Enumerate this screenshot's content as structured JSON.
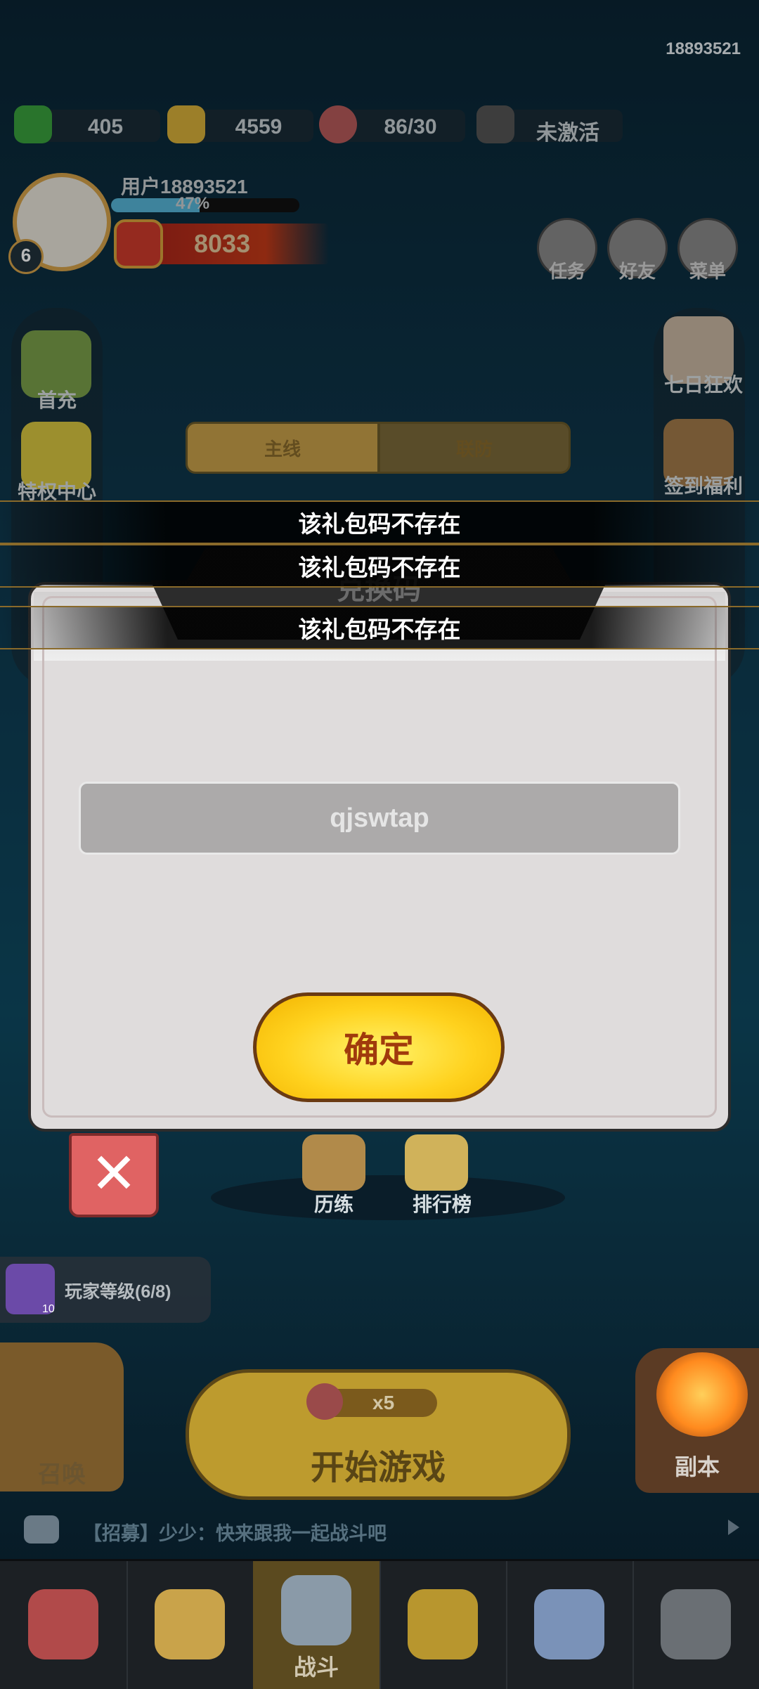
{
  "header": {
    "uid": "18893521"
  },
  "resources": [
    {
      "name": "gem",
      "value": "405",
      "color": "#3aa13d"
    },
    {
      "name": "coin",
      "value": "4559",
      "color": "#d8b03a"
    },
    {
      "name": "stamina",
      "value": "86/30",
      "color": "#b85a5a"
    },
    {
      "name": "ad-card",
      "value": "未激活",
      "color": "#555555"
    }
  ],
  "player": {
    "name": "用户18893521",
    "xp_percent_label": "47%",
    "xp_fraction": 0.47,
    "level": "6",
    "power": "8033"
  },
  "top_right_buttons": [
    {
      "icon": "scroll-icon",
      "label": "任务"
    },
    {
      "icon": "friends-icon",
      "label": "好友"
    },
    {
      "icon": "menu-icon",
      "label": "菜单"
    }
  ],
  "left_menu": [
    {
      "icon": "first-recharge-icon",
      "label": "首充"
    },
    {
      "icon": "privilege-card-icon",
      "label": "特权中心"
    }
  ],
  "right_menu": [
    {
      "icon": "seven-day-icon",
      "label": "七日狂欢"
    },
    {
      "icon": "calendar-icon",
      "label": "签到福利"
    }
  ],
  "mode_tabs": [
    {
      "label": "主线"
    },
    {
      "label": "联防"
    }
  ],
  "toasts": [
    "该礼包码不存在",
    "该礼包码不存在",
    "该礼包码不存在"
  ],
  "dialog": {
    "title": "兑换码",
    "code_value": "qjswtap",
    "confirm_label": "确定",
    "close_glyph": "✕"
  },
  "activities": [
    {
      "icon": "training-icon",
      "label": "历练"
    },
    {
      "icon": "ranking-icon",
      "label": "排行榜"
    }
  ],
  "player_level_task": {
    "label": "玩家等级(6/8)",
    "count": "10"
  },
  "summon": {
    "label": "召唤"
  },
  "start_game": {
    "label": "开始游戏",
    "cost": "x5"
  },
  "dungeon": {
    "label": "副本"
  },
  "chat": {
    "message": "【招募】少少：快来跟我一起战斗吧"
  },
  "bottom_nav": [
    {
      "icon": "shop-icon",
      "label": "",
      "active": false
    },
    {
      "icon": "hero-icon",
      "label": "",
      "active": false
    },
    {
      "icon": "battle-sword-icon",
      "label": "战斗",
      "active": true
    },
    {
      "icon": "equipment-helmet-icon",
      "label": "",
      "active": false
    },
    {
      "icon": "castle-icon",
      "label": "",
      "active": false
    },
    {
      "icon": "guild-shield-icon",
      "label": "",
      "active": false
    }
  ]
}
